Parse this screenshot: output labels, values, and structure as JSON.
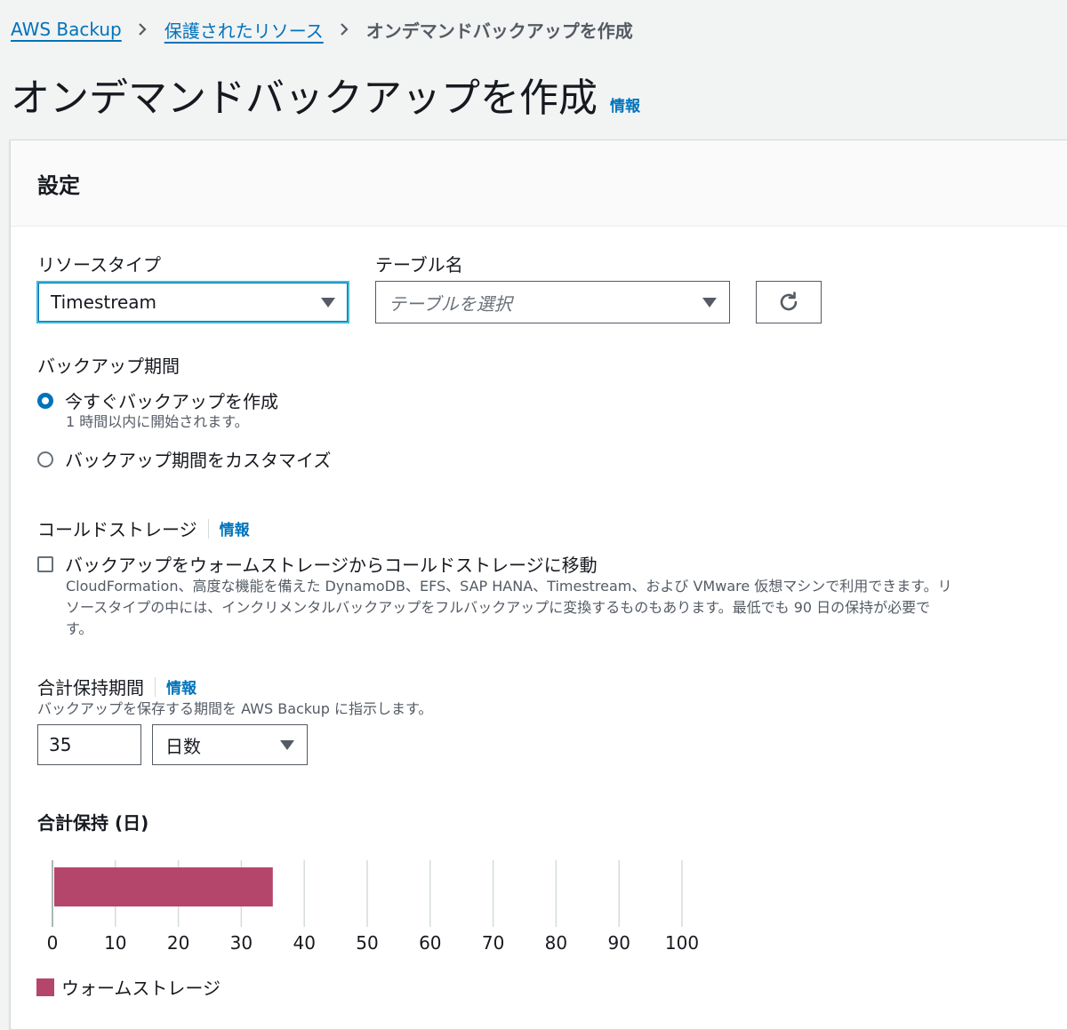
{
  "breadcrumb": {
    "items": [
      "AWS Backup",
      "保護されたリソース"
    ],
    "current": "オンデマンドバックアップを作成"
  },
  "page": {
    "title": "オンデマンドバックアップを作成",
    "info": "情報"
  },
  "settings": {
    "heading": "設定",
    "resource_type": {
      "label": "リソースタイプ",
      "value": "Timestream"
    },
    "table_name": {
      "label": "テーブル名",
      "placeholder": "テーブルを選択"
    },
    "refresh_icon": "refresh-icon",
    "backup_window": {
      "label": "バックアップ期間",
      "options": [
        {
          "label": "今すぐバックアップを作成",
          "description": "1 時間以内に開始されます。",
          "selected": true
        },
        {
          "label": "バックアップ期間をカスタマイズ",
          "selected": false
        }
      ]
    },
    "cold_storage": {
      "label": "コールドストレージ",
      "info": "情報",
      "checkbox_label": "バックアップをウォームストレージからコールドストレージに移動",
      "checked": false,
      "description_lines": [
        "CloudFormation、高度な機能を備えた DynamoDB、EFS、SAP HANA、Timestream、および VMware 仮想マシンで利用できます。リ",
        "ソースタイプの中には、インクリメンタルバックアップをフルバックアップに変換するものもあります。最低でも 90 日の保持が必要で",
        "す。"
      ]
    },
    "retention": {
      "label": "合計保持期間",
      "info": "情報",
      "description": "バックアップを保存する期間を AWS Backup に指示します。",
      "value": "35",
      "unit": "日数"
    }
  },
  "chart_data": {
    "type": "bar",
    "orientation": "horizontal",
    "title": "合計保持 (日)",
    "categories": [
      ""
    ],
    "series": [
      {
        "name": "ウォームストレージ",
        "values": [
          35
        ],
        "color": "#b5466b"
      }
    ],
    "xlim": [
      0,
      100
    ],
    "xticks": [
      "0",
      "10",
      "20",
      "30",
      "40",
      "50",
      "60",
      "70",
      "80",
      "90",
      "100"
    ],
    "grid": true,
    "legend": "bottom-left"
  }
}
